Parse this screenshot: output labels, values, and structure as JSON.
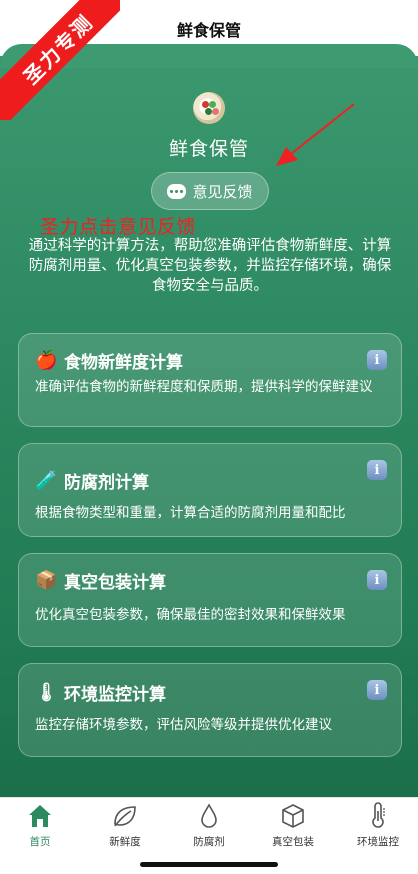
{
  "header": {
    "title": "鲜食保管"
  },
  "app": {
    "name": "鲜食保管"
  },
  "ribbon": {
    "text": "圣力专测"
  },
  "feedback": {
    "label": "意见反馈"
  },
  "annotation": {
    "text": "圣力点击意见反馈"
  },
  "intro": {
    "text": "通过科学的计算方法，帮助您准确评估食物新鲜度、计算防腐剂用量、优化真空包装参数，并监控存储环境，确保食物安全与品质。"
  },
  "cards": [
    {
      "icon": "apple-icon",
      "glyph": "🍎",
      "title": "食物新鲜度计算",
      "desc": "准确评估食物的新鲜程度和保质期，提供科学的保鲜建议",
      "info": "i"
    },
    {
      "icon": "test-tube-icon",
      "glyph": "🧪",
      "title": "防腐剂计算",
      "desc": "根据食物类型和重量，计算合适的防腐剂用量和配比",
      "info": "i"
    },
    {
      "icon": "package-icon",
      "glyph": "📦",
      "title": "真空包装计算",
      "desc": "优化真空包装参数，确保最佳的密封效果和保鲜效果",
      "info": "i"
    },
    {
      "icon": "thermometer-icon",
      "glyph": "🌡",
      "title": "环境监控计算",
      "desc": "监控存储环境参数，评估风险等级并提供优化建议",
      "info": "i"
    }
  ],
  "tabs": [
    {
      "label": "首页",
      "icon": "home-icon",
      "active": true
    },
    {
      "label": "新鲜度",
      "icon": "leaf-icon",
      "active": false
    },
    {
      "label": "防腐剂",
      "icon": "drop-icon",
      "active": false
    },
    {
      "label": "真空包装",
      "icon": "box-icon",
      "active": false
    },
    {
      "label": "环境监控",
      "icon": "thermometer-icon",
      "active": false
    }
  ],
  "colors": {
    "accent": "#2c8a5f",
    "annotation": "#ee2222",
    "ribbon": "#ee1c1c"
  }
}
